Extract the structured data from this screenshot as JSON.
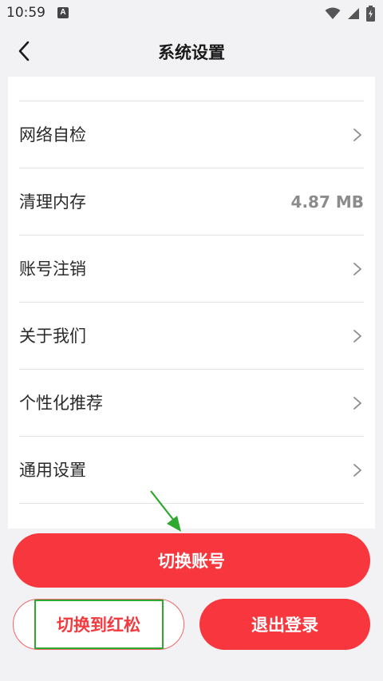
{
  "status_bar": {
    "time": "10:59",
    "notification_badge": "A"
  },
  "header": {
    "title": "系统设置"
  },
  "settings": {
    "items": [
      {
        "label": "网络自检",
        "kind": "chevron"
      },
      {
        "label": "清理内存",
        "kind": "value",
        "value": "4.87 MB"
      },
      {
        "label": "账号注销",
        "kind": "chevron"
      },
      {
        "label": "关于我们",
        "kind": "chevron"
      },
      {
        "label": "个性化推荐",
        "kind": "chevron"
      },
      {
        "label": "通用设置",
        "kind": "chevron"
      }
    ]
  },
  "actions": {
    "switch_account": "切换账号",
    "switch_to_hongsong": "切换到红松",
    "logout": "退出登录"
  },
  "colors": {
    "accent_red": "#f7363e",
    "highlight_green": "#2ea82e"
  },
  "icons": {
    "back": "chevron-left-icon",
    "row_chevron": "chevron-right-icon",
    "wifi": "wifi-icon",
    "signal": "signal-icon",
    "battery": "battery-charging-icon",
    "hint_arrow": "green-arrow-icon"
  }
}
